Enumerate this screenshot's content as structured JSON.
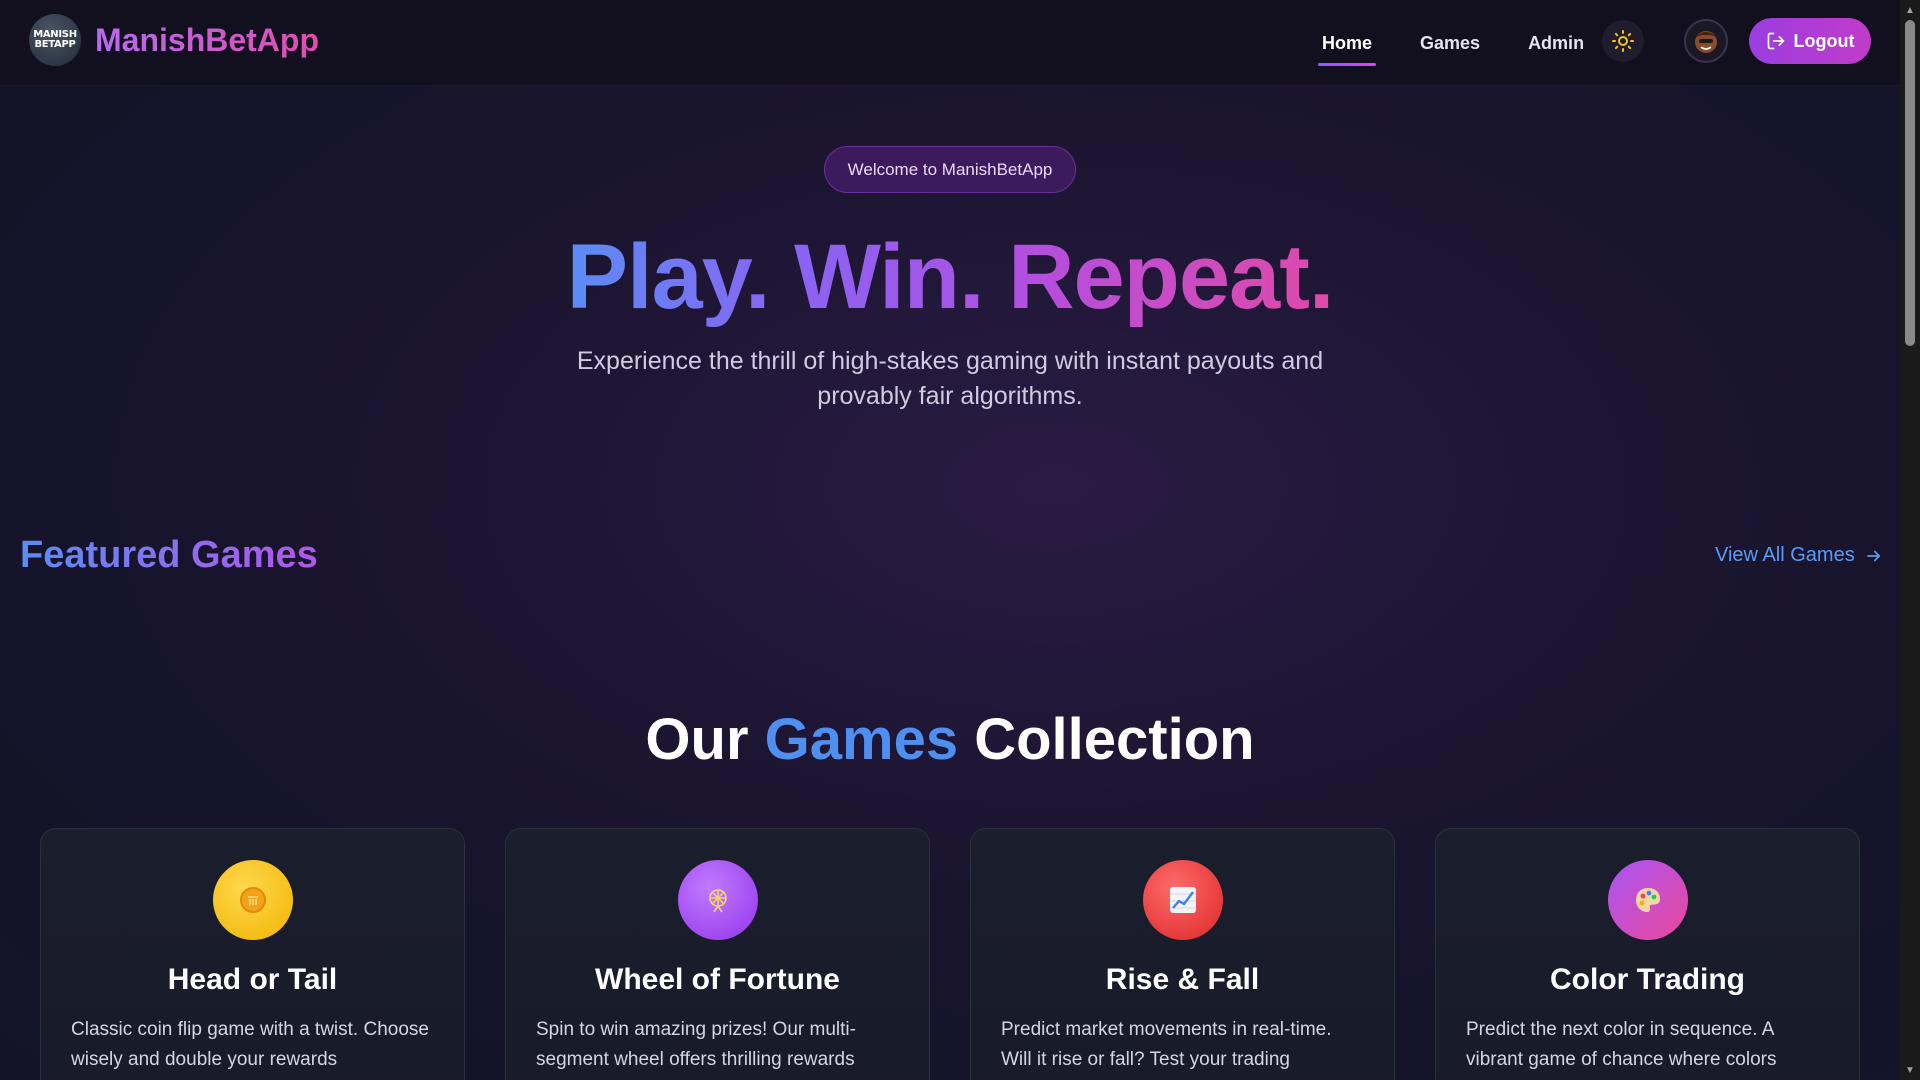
{
  "brand": {
    "logo_line1": "MANISH",
    "logo_line2": "BETAPP",
    "name": "ManishBetApp"
  },
  "nav": {
    "links": [
      {
        "label": "Home",
        "active": true
      },
      {
        "label": "Games",
        "active": false
      },
      {
        "label": "Admin",
        "active": false
      }
    ],
    "theme_icon": "sun-icon",
    "avatar_icon": "user-avatar",
    "logout_label": "Logout",
    "logout_icon": "logout-icon"
  },
  "hero": {
    "pill": "Welcome to ManishBetApp",
    "title_words": [
      "Play.",
      "Win.",
      "Repeat."
    ],
    "subtitle": "Experience the thrill of high-stakes gaming with instant payouts and provably fair algorithms."
  },
  "featured": {
    "title": "Featured Games",
    "view_all": "View All Games",
    "view_all_icon": "arrow-right-icon"
  },
  "collection": {
    "title_pre": "Our ",
    "title_accent": "Games",
    "title_post": " Collection"
  },
  "games": [
    {
      "title": "Head or Tail",
      "icon": "coin-icon",
      "color": "#f5c518",
      "desc": "Classic coin flip game with a twist. Choose wisely and double your rewards"
    },
    {
      "title": "Wheel of Fortune",
      "icon": "ferris-wheel-icon",
      "color": "#a855f7",
      "desc": "Spin to win amazing prizes! Our multi-segment wheel offers thrilling rewards"
    },
    {
      "title": "Rise & Fall",
      "icon": "chart-up-icon",
      "color": "#ef4444",
      "desc": "Predict market movements in real-time. Will it rise or fall? Test your trading"
    },
    {
      "title": "Color Trading",
      "icon": "palette-icon",
      "color": "#c026d3",
      "desc": "Predict the next color in sequence. A vibrant game of chance where colors"
    }
  ],
  "colors": {
    "accent_blue": "#4f8ff0",
    "accent_purple": "#a855f7",
    "accent_pink": "#df4aa8"
  }
}
